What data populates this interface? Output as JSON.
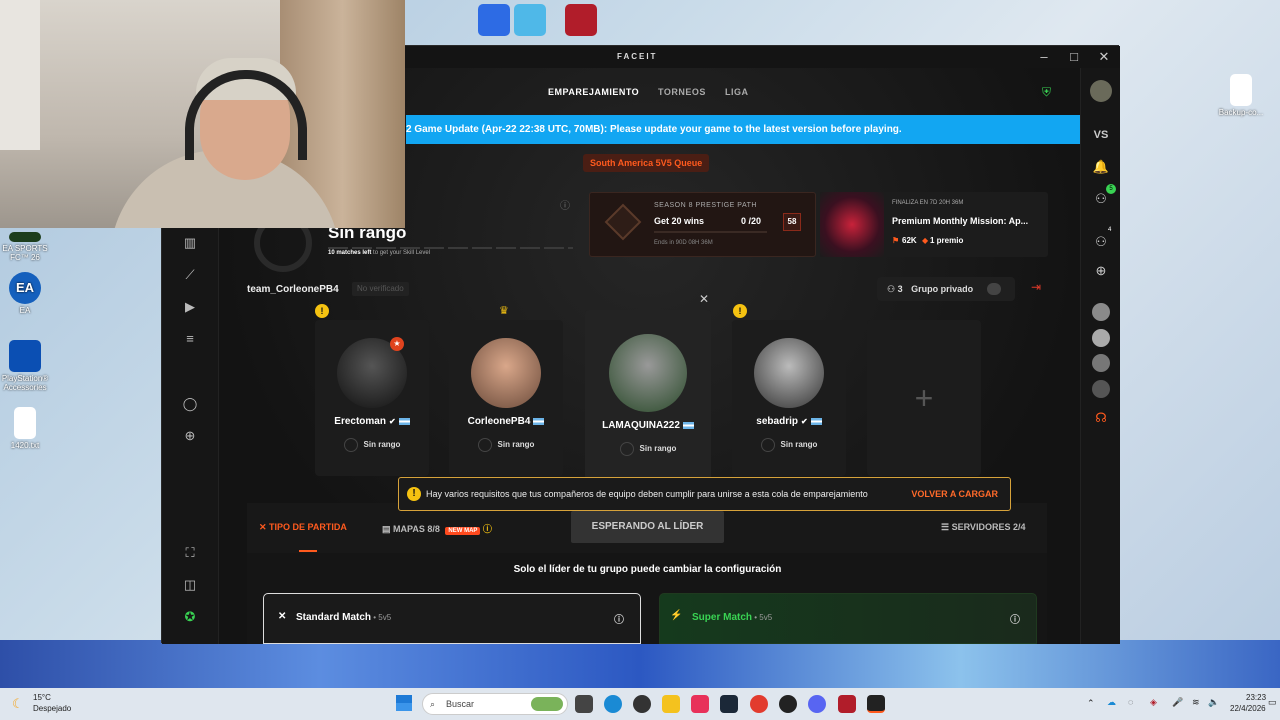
{
  "desktop": {
    "icons": [
      {
        "label": "EA SPORTS FC™ 26"
      },
      {
        "label": "EA"
      },
      {
        "label": "PlayStation® Accessories"
      },
      {
        "label": "1420.txt"
      },
      {
        "label": "Backup-co..."
      }
    ]
  },
  "app": {
    "logo": "FACEIT",
    "nav": [
      "EMPAREJAMIENTO",
      "TORNEOS",
      "LIGA"
    ],
    "banner": "2 Game Update (Apr-22 22:38 UTC, 70MB): Please update your game to the latest version before playing.",
    "queue": "South America 5V5 Queue",
    "rank": {
      "title": "Sin rango",
      "sub_bold": "10 matches left",
      "sub_rest": " to get your Skill Level"
    },
    "prestige": {
      "label": "SEASON 8 PRESTIGE PATH",
      "goal": "Get 20 wins",
      "progress": "0 /20",
      "level": "58",
      "ends": "Ends in 90D 08H 36M"
    },
    "mission": {
      "ends": "FINALIZA EN 7D 20H 36M",
      "title": "Premium Monthly Mission: Ap...",
      "points": "62K",
      "prize": "1 premio"
    },
    "team": {
      "name": "team_CorleonePB4",
      "status": "No verificado",
      "members_count": "3",
      "private_label": "Grupo privado"
    },
    "players": [
      {
        "name": "Erectoman",
        "rank": "Sin rango"
      },
      {
        "name": "CorleonePB4",
        "rank": "Sin rango"
      },
      {
        "name": "LAMAQUINA222",
        "rank": "Sin rango"
      },
      {
        "name": "sebadrip",
        "rank": "Sin rango"
      }
    ],
    "warning": {
      "text": "Hay varios requisitos que tus compañeros de equipo deben cumplir para unirse a esta cola de emparejamiento",
      "action": "VOLVER A CARGAR"
    },
    "tabs": {
      "match_type": "TIPO DE PARTIDA",
      "maps": "MAPAS 8/8",
      "new_map": "NEW MAP",
      "waiting": "ESPERANDO AL LÍDER",
      "servers": "SERVIDORES 2/4"
    },
    "config_text": "Solo el líder de tu grupo puede cambiar la configuración",
    "modes": [
      {
        "name": "Standard Match",
        "sub": " • 5v5"
      },
      {
        "name": "Super Match",
        "sub": " • 5v5"
      }
    ],
    "rightbar": {
      "vs": "VS",
      "friends_count": "5",
      "party_count": "4"
    }
  },
  "taskbar": {
    "weather_temp": "15°C",
    "weather_text": "Despejado",
    "search_placeholder": "Buscar",
    "time": "23:23",
    "date": "22/4/2026"
  },
  "colors": {
    "accent": "#ff5500",
    "banner": "#12a6f2",
    "warning": "#f5c211"
  }
}
